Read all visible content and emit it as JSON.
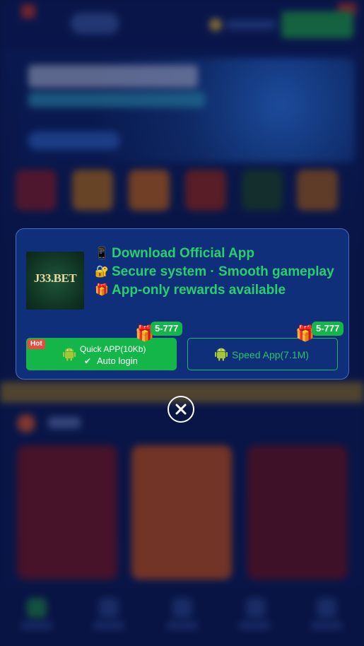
{
  "popup": {
    "logo_text": "J33.BET",
    "lines": [
      {
        "icon": "mobile-phone-icon",
        "text": "Download Official App"
      },
      {
        "icon": "lock-icon",
        "text": "Secure system · Smooth gameplay"
      },
      {
        "icon": "gift-icon",
        "text": "App-only rewards available"
      }
    ],
    "quick_button": {
      "hot_label": "Hot",
      "line1": "Quick APP(10Kb)",
      "line2": "Auto login",
      "badge": "5-777"
    },
    "speed_button": {
      "label": "Speed App(7.1M)",
      "badge": "5-777"
    }
  },
  "colors": {
    "accent_green": "#14b64a",
    "text_green": "#27d06a",
    "popup_bg": "#0f2f7a",
    "hot_red": "#e94b3c"
  }
}
